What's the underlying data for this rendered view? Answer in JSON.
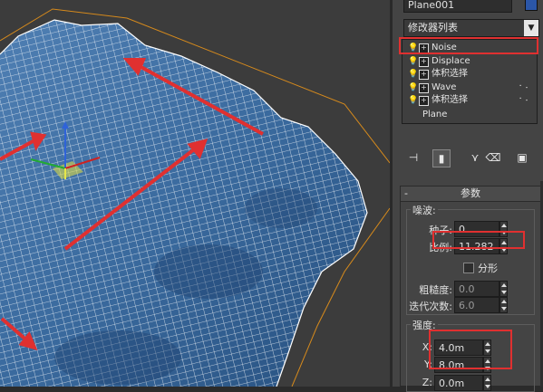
{
  "object_name": "Plane001",
  "object_color": "#2b56a8",
  "modifier_list_label": "修改器列表",
  "stack": [
    {
      "label": "Noise",
      "dots": false
    },
    {
      "label": "Displace",
      "dots": false
    },
    {
      "label": "体积选择",
      "dots": false
    },
    {
      "label": "Wave",
      "dots": true
    },
    {
      "label": "体积选择",
      "dots": true
    },
    {
      "label": "Plane",
      "dots": false
    }
  ],
  "toolbar": [
    {
      "icon": "pin-stack-icon",
      "glyph": "⊣"
    },
    {
      "icon": "show-end-result-icon",
      "glyph": "▮"
    },
    {
      "icon": "make-unique-icon",
      "glyph": "⋎"
    },
    {
      "icon": "remove-modifier-icon",
      "glyph": "🗑"
    },
    {
      "icon": "configure-sets-icon",
      "glyph": "▣"
    }
  ],
  "params": {
    "rollout_title": "参数",
    "rollout_toggle": "-",
    "noise_group": "噪波:",
    "seed_label": "种子:",
    "seed_value": "0",
    "scale_label": "比例:",
    "scale_value": "11.282",
    "fractal_label": "分形",
    "roughness_label": "粗糙度:",
    "roughness_value": "0.0",
    "iterations_label": "迭代次数:",
    "iterations_value": "6.0",
    "strength_group": "强度:",
    "x_label": "X:",
    "x_value": "4.0m",
    "y_label": "Y:",
    "y_value": "8.0m",
    "z_label": "Z:",
    "z_value": "0.0m"
  },
  "colors": {
    "highlight": "#e03030",
    "viewport_bg": "#3c3c3c",
    "mesh_wire": "#ffffff",
    "mesh_fill": "#2f5d8c",
    "bounding_box": "#d68a1c"
  }
}
